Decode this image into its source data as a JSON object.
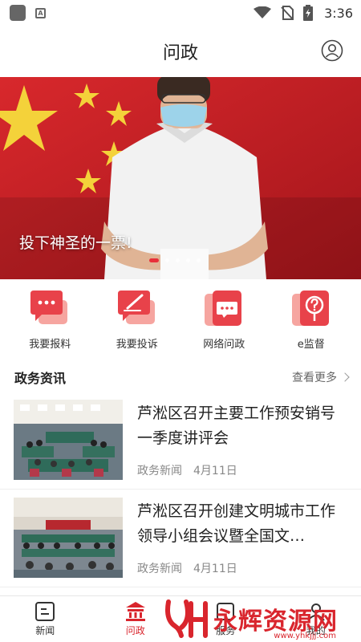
{
  "status_bar": {
    "time": "3:36"
  },
  "header": {
    "title": "问政"
  },
  "banner": {
    "caption": "投下神圣的一票!",
    "slide_count": 5,
    "active_slide": 1
  },
  "quick_actions": [
    {
      "label": "我要报料",
      "icon": "chat-dots-icon"
    },
    {
      "label": "我要投诉",
      "icon": "pen-chat-icon"
    },
    {
      "label": "网络问政",
      "icon": "message-dots-icon"
    },
    {
      "label": "e监督",
      "icon": "question-pin-icon"
    }
  ],
  "section": {
    "title": "政务资讯",
    "more": "查看更多"
  },
  "news": [
    {
      "title": "芦淞区召开主要工作预安销号一季度讲评会",
      "category": "政务新闻",
      "date": "4月11日"
    },
    {
      "title": "芦淞区召开创建文明城市工作领导小组会议暨全国文…",
      "category": "政务新闻",
      "date": "4月11日"
    }
  ],
  "bottom_nav": [
    {
      "label": "新闻",
      "icon": "news-icon",
      "active": false
    },
    {
      "label": "问政",
      "icon": "government-building-icon",
      "active": true
    },
    {
      "label": "服务",
      "icon": "service-icon",
      "active": false
    },
    {
      "label": "我的",
      "icon": "user-icon",
      "active": false
    }
  ],
  "watermark": {
    "text": "永辉资源网",
    "url": "www.yhkjjj.com"
  },
  "colors": {
    "accent": "#d9252d",
    "icon_pink": "#f08a8a",
    "icon_red": "#e8424a"
  }
}
